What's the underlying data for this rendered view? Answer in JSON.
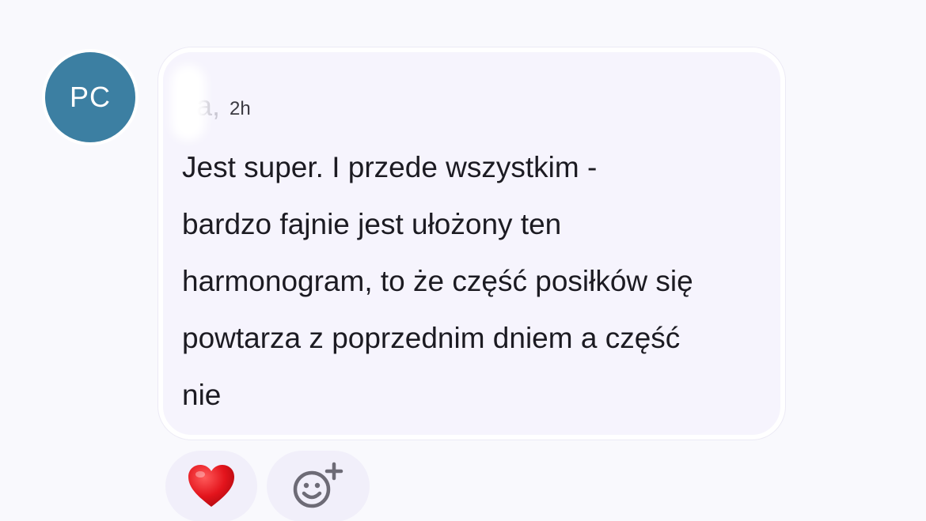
{
  "comment": {
    "avatar_initials": "PC",
    "author_name": "ka,",
    "timestamp": "2h",
    "message_lines": [
      "Jest super. I przede wszystkim -",
      "bardzo fajnie jest ułożony ten",
      "harmonogram, to że część posiłków się",
      "powtarza z poprzednim dniem a część",
      "nie"
    ]
  },
  "reactions": {
    "existing_icon": "heart-icon",
    "add_icon": "add-reaction-icon"
  },
  "colors": {
    "avatar": "#3c7fa2",
    "bubble": "#f6f4fd",
    "heart": "#e01b24",
    "text": "#1c1b22"
  }
}
